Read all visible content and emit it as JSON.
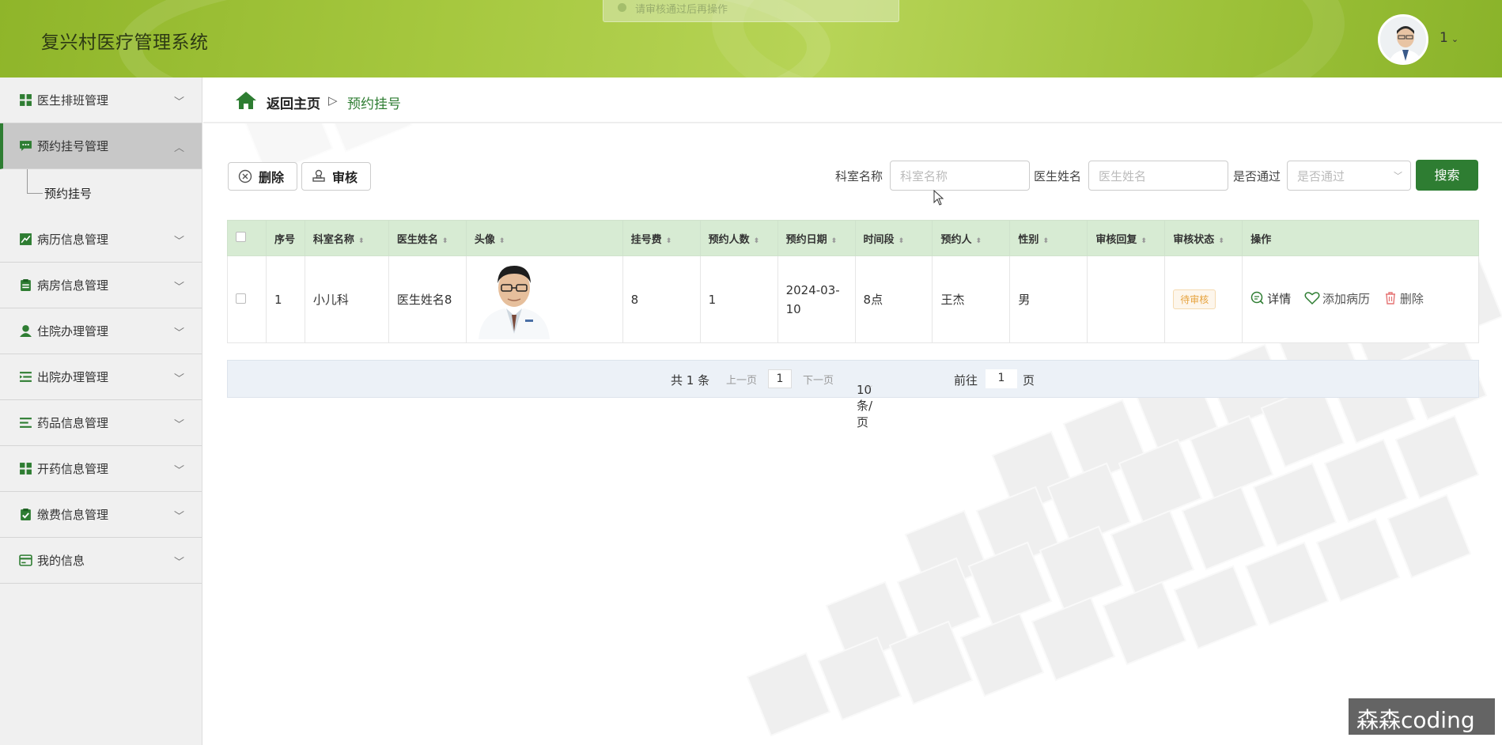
{
  "app": {
    "title": "复兴村医疗管理系统",
    "toast": "请审核通过后再操作",
    "user": "1"
  },
  "sidebar": {
    "items": [
      {
        "label": "医生排班管理",
        "icon": "grid-icon"
      },
      {
        "label": "预约挂号管理",
        "icon": "message-icon",
        "active": true,
        "sub": [
          "预约挂号"
        ]
      },
      {
        "label": "病历信息管理",
        "icon": "chart-line-icon"
      },
      {
        "label": "病房信息管理",
        "icon": "clipboard-icon"
      },
      {
        "label": "住院办理管理",
        "icon": "user-icon"
      },
      {
        "label": "出院办理管理",
        "icon": "list-indent-icon"
      },
      {
        "label": "药品信息管理",
        "icon": "list-icon"
      },
      {
        "label": "开药信息管理",
        "icon": "grid-icon"
      },
      {
        "label": "缴费信息管理",
        "icon": "clipboard-check-icon"
      },
      {
        "label": "我的信息",
        "icon": "card-icon"
      }
    ]
  },
  "breadcrumb": {
    "home": "返回主页",
    "separator": "▷",
    "current": "预约挂号"
  },
  "toolbar": {
    "delete_label": "删除",
    "audit_label": "审核"
  },
  "search": {
    "dept_label": "科室名称",
    "dept_placeholder": "科室名称",
    "doctor_label": "医生姓名",
    "doctor_placeholder": "医生姓名",
    "pass_label": "是否通过",
    "pass_placeholder": "是否通过",
    "button": "搜索"
  },
  "table": {
    "columns": [
      "序号",
      "科室名称",
      "医生姓名",
      "头像",
      "挂号费",
      "预约人数",
      "预约日期",
      "时间段",
      "预约人",
      "性别",
      "审核回复",
      "审核状态",
      "操作"
    ],
    "rows": [
      {
        "index": "1",
        "dept": "小儿科",
        "doctor": "医生姓名8",
        "fee": "8",
        "count": "1",
        "date": "2024-03-10",
        "time_slot": "8点",
        "patient": "王杰",
        "gender": "男",
        "reply": "",
        "status": "待审核",
        "actions": {
          "detail": "详情",
          "add_record": "添加病历",
          "delete": "删除"
        }
      }
    ]
  },
  "pagination": {
    "total": "共 1 条",
    "prev": "上一页",
    "current_page": "1",
    "next": "下一页",
    "page_size": "10条/页",
    "goto_label": "前往",
    "goto_value": "1",
    "goto_suffix": "页"
  },
  "watermark": "森森coding",
  "colors": {
    "primary": "#2e7d32",
    "header": "#a6c83f",
    "table_header": "#d7ebd3",
    "status_pending": "#e6a23c"
  }
}
